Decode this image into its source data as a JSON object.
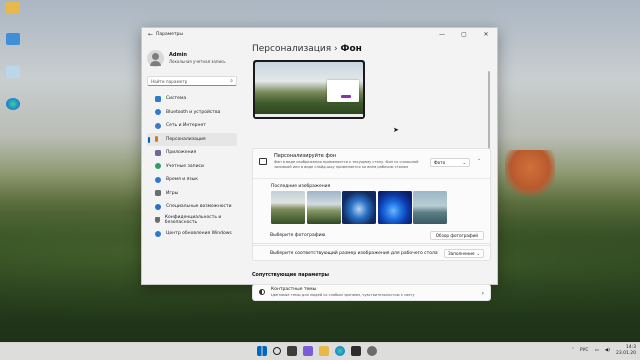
{
  "window": {
    "title": "Параметры",
    "back_glyph": "←",
    "controls": [
      "—",
      "▢",
      "✕"
    ]
  },
  "user": {
    "name": "Admin",
    "account_type": "Локальная учетная запись"
  },
  "search": {
    "placeholder": "Найти параметр",
    "icon": "search-icon"
  },
  "nav": [
    {
      "label": "Система",
      "icon": "monitor-icon",
      "color": "#2b7bd3"
    },
    {
      "label": "Bluetooth и устройства",
      "icon": "bluetooth-icon",
      "color": "#2b7bd3"
    },
    {
      "label": "Сеть и Интернет",
      "icon": "network-icon",
      "color": "#3d7ac0"
    },
    {
      "label": "Персонализация",
      "icon": "brush-icon",
      "color": "#d07c1b",
      "active": true
    },
    {
      "label": "Приложения",
      "icon": "apps-icon",
      "color": "#6a6a9b"
    },
    {
      "label": "Учетные записи",
      "icon": "accounts-icon",
      "color": "#2e9e61"
    },
    {
      "label": "Время и язык",
      "icon": "time-language-icon",
      "color": "#2b7bd3"
    },
    {
      "label": "Игры",
      "icon": "games-icon",
      "color": "#6d6d6d"
    },
    {
      "label": "Специальные возможности",
      "icon": "accessibility-icon",
      "color": "#2b6fc9"
    },
    {
      "label": "Конфиденциальность и безопасность",
      "icon": "shield-icon",
      "color": "#6d6d6d"
    },
    {
      "label": "Центр обновления Windows",
      "icon": "update-icon",
      "color": "#2b7bd3"
    }
  ],
  "breadcrumb": {
    "parent": "Персонализация",
    "separator": "›",
    "current": "Фон"
  },
  "personalize": {
    "title": "Персонализируйте фон",
    "description": "Фон в виде изображения применяется к текущему столу. Фон со сплошной заливкой или в виде слайд-шоу применяется ко всем рабочим столам",
    "selected": "Фото",
    "collapse_glyph": "˄"
  },
  "recent": {
    "label": "Последние изображения",
    "thumbs": [
      "landscape-1",
      "landscape-2",
      "windows-blue-1",
      "windows-bloom",
      "lake"
    ]
  },
  "choose_photo": {
    "label": "Выберите фотографию",
    "button": "Обзор фотографий"
  },
  "fit": {
    "label": "Выберите соответствующий размер изображения для рабочего стола",
    "selected": "Заполнение"
  },
  "related": {
    "heading": "Сопутствующие параметры",
    "items": [
      {
        "title": "Контрастные темы",
        "subtitle": "Цветовые темы для людей со слабым зрением, чувствительностью к свету"
      }
    ]
  },
  "taskbar": {
    "lang": "РУС",
    "time": "14:3",
    "date": "23.01.20",
    "accent": "#0067c0"
  }
}
